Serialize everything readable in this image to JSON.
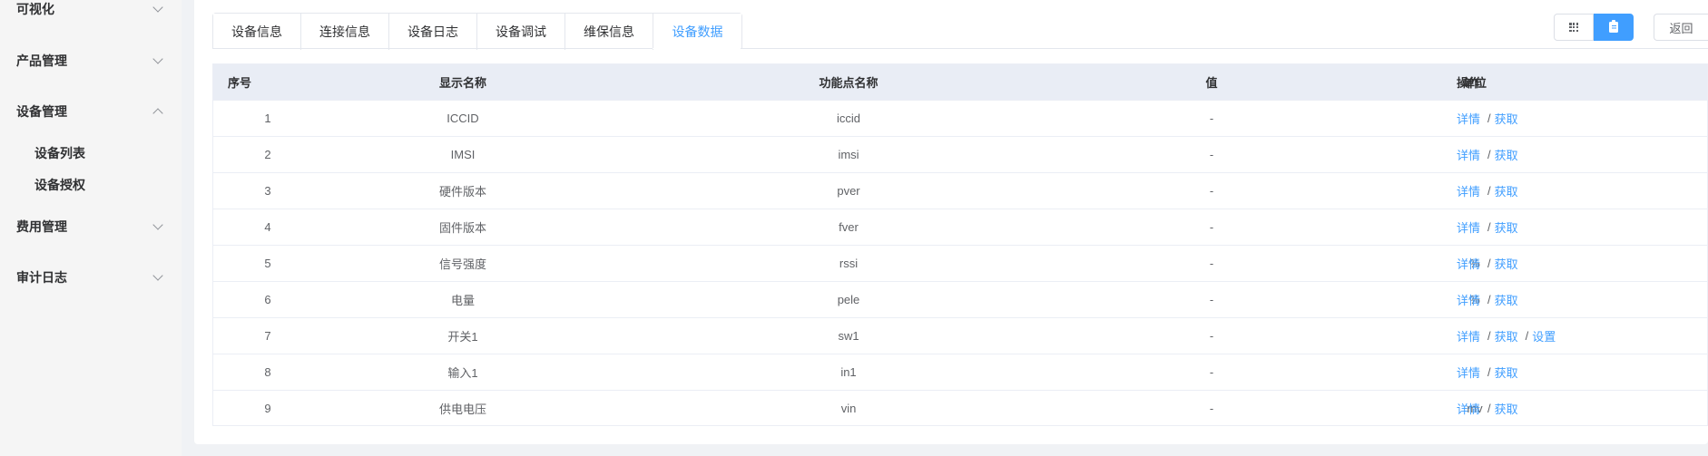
{
  "sidebar": {
    "items": [
      {
        "label": "可视化",
        "expanded": false
      },
      {
        "label": "产品管理",
        "expanded": false
      },
      {
        "label": "设备管理",
        "expanded": true
      },
      {
        "label": "费用管理",
        "expanded": false
      },
      {
        "label": "审计日志",
        "expanded": false
      }
    ],
    "subitems": [
      {
        "label": "设备列表"
      },
      {
        "label": "设备授权"
      }
    ]
  },
  "tabs": [
    {
      "label": "设备信息"
    },
    {
      "label": "连接信息"
    },
    {
      "label": "设备日志"
    },
    {
      "label": "设备调试"
    },
    {
      "label": "维保信息"
    },
    {
      "label": "设备数据",
      "active": true
    }
  ],
  "toolbar": {
    "back_label": "返回"
  },
  "table": {
    "headers": {
      "index": "序号",
      "name": "显示名称",
      "key": "功能点名称",
      "value": "值",
      "unit": "单位",
      "ops": "操作"
    },
    "rows": [
      {
        "index": "1",
        "name": "ICCID",
        "key": "iccid",
        "value": "-",
        "unit": "",
        "ops": [
          "详情",
          "获取"
        ]
      },
      {
        "index": "2",
        "name": "IMSI",
        "key": "imsi",
        "value": "-",
        "unit": "",
        "ops": [
          "详情",
          "获取"
        ]
      },
      {
        "index": "3",
        "name": "硬件版本",
        "key": "pver",
        "value": "-",
        "unit": "",
        "ops": [
          "详情",
          "获取"
        ]
      },
      {
        "index": "4",
        "name": "固件版本",
        "key": "fver",
        "value": "-",
        "unit": "",
        "ops": [
          "详情",
          "获取"
        ]
      },
      {
        "index": "5",
        "name": "信号强度",
        "key": "rssi",
        "value": "-",
        "unit": "%",
        "ops": [
          "详情",
          "获取"
        ]
      },
      {
        "index": "6",
        "name": "电量",
        "key": "pele",
        "value": "-",
        "unit": "%",
        "ops": [
          "详情",
          "获取"
        ]
      },
      {
        "index": "7",
        "name": "开关1",
        "key": "sw1",
        "value": "-",
        "unit": "",
        "ops": [
          "详情",
          "获取",
          "设置"
        ]
      },
      {
        "index": "8",
        "name": "输入1",
        "key": "in1",
        "value": "-",
        "unit": "",
        "ops": [
          "详情",
          "获取"
        ]
      },
      {
        "index": "9",
        "name": "供电电压",
        "key": "vin",
        "value": "-",
        "unit": "mv",
        "ops": [
          "详情",
          "获取"
        ]
      }
    ],
    "op_separator": "/"
  },
  "colors": {
    "accent": "#409eff",
    "header_bg": "#e9edf5",
    "sidebar_bg": "#f5f5f5"
  }
}
